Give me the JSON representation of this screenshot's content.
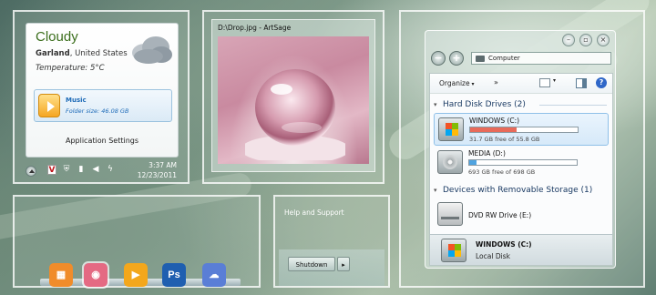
{
  "weather": {
    "condition": "Cloudy",
    "city": "Garland",
    "region": ", United States",
    "temperature": "Temperature: 5°C",
    "icon": "cloud-icon"
  },
  "music": {
    "label": "Music",
    "folder_size": "Folder size: 46.08 GB",
    "icon": "play-icon"
  },
  "gadget_settings": "Application Settings",
  "taskbar": {
    "time": "3:37 AM",
    "date": "12/23/2011",
    "tray_icons": [
      "antivirus-icon",
      "shield-icon",
      "network-icon",
      "volume-icon",
      "power-icon"
    ]
  },
  "photo_viewer": {
    "title": "D:\\Drop.jpg - ArtSage"
  },
  "explorer": {
    "address": "Computer",
    "toolbar": {
      "organize": "Organize",
      "more": "»",
      "help": "?"
    },
    "groups": [
      {
        "title": "Hard Disk Drives (2)",
        "drives": [
          {
            "name": "WINDOWS (C:)",
            "free": "31.7 GB free of 55.8 GB",
            "used_fraction": 0.43,
            "bar_color": "#e86a5a",
            "icon": "windows-drive-icon"
          },
          {
            "name": "MEDIA (D:)",
            "free": "693 GB free of 698 GB",
            "used_fraction": 0.07,
            "bar_color": "#4fa3e0",
            "icon": "hard-drive-icon"
          }
        ]
      },
      {
        "title": "Devices with Removable Storage (1)",
        "drives": [
          {
            "name": "DVD RW Drive (E:)",
            "icon": "dvd-drive-icon"
          }
        ]
      }
    ],
    "details": {
      "name": "WINDOWS (C:)",
      "type": "Local Disk"
    }
  },
  "dock": {
    "icons": [
      {
        "name": "cards-app-icon",
        "glyph": "▦",
        "color": "#f08c2a"
      },
      {
        "name": "camera-app-icon",
        "glyph": "◉",
        "color": "#e46a83"
      },
      {
        "name": "media-player-icon",
        "glyph": "▶",
        "color": "#f3a71c"
      },
      {
        "name": "photoshop-icon",
        "glyph": "Ps",
        "color": "#1f5fb0"
      },
      {
        "name": "cloud-sync-icon",
        "glyph": "☁",
        "color": "#5a7ed6"
      }
    ]
  },
  "start_menu": {
    "help": "Help and Support",
    "shutdown": "Shutdown",
    "arrow": "▸"
  }
}
